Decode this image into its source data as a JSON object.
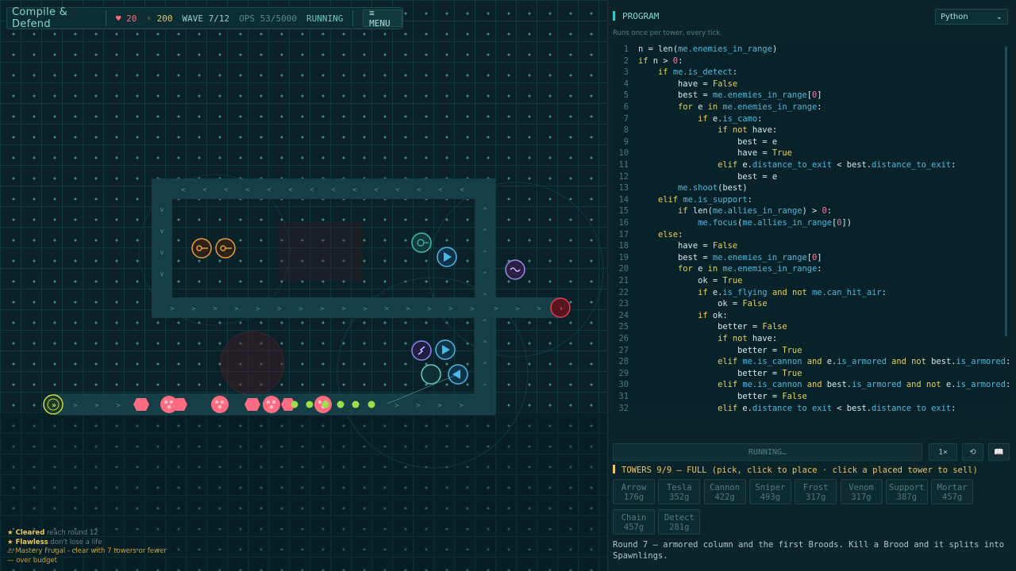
{
  "hud": {
    "title": "Compile & Defend",
    "lives": "♥ 20",
    "gold": "◦ 200",
    "wave": "WAVE 7/12",
    "ops": "OPS 53/5000",
    "state": "RUNNING",
    "menu_label": "≡ MENU"
  },
  "achievements": [
    {
      "name": "★ Cleared",
      "desc": " reach round 12"
    },
    {
      "name": "★ Flawless",
      "desc": " don't lose a life"
    },
    {
      "name": "⚠ Mastery Frugal",
      "desc": " - clear with 7 towers or fewer — over budget"
    }
  ],
  "panel": {
    "title": "PROGRAM",
    "language": "Python",
    "language_arrow": "⌄",
    "subtitle": "Runs once per tower, every tick.",
    "run_status": "RUNNING…",
    "speed_label": "1×",
    "reset_label": "⟲",
    "docs_label": "📖"
  },
  "code": [
    [
      [
        "pl",
        "n = "
      ],
      [
        "fn",
        "len"
      ],
      [
        "pl",
        "("
      ],
      [
        "at",
        "me.enemies_in_range"
      ],
      [
        "pl",
        ")"
      ]
    ],
    [
      [
        "kw",
        "if"
      ],
      [
        "pl",
        " n > "
      ],
      [
        "nm",
        "0"
      ],
      [
        "pl",
        ":"
      ]
    ],
    [
      [
        "pl",
        "    "
      ],
      [
        "kw",
        "if"
      ],
      [
        "pl",
        " "
      ],
      [
        "at",
        "me.is_detect"
      ],
      [
        "pl",
        ":"
      ]
    ],
    [
      [
        "pl",
        "        have = "
      ],
      [
        "kw",
        "False"
      ]
    ],
    [
      [
        "pl",
        "        best = "
      ],
      [
        "at",
        "me.enemies_in_range"
      ],
      [
        "pl",
        "["
      ],
      [
        "nm",
        "0"
      ],
      [
        "pl",
        "]"
      ]
    ],
    [
      [
        "pl",
        "        "
      ],
      [
        "kw",
        "for"
      ],
      [
        "pl",
        " e "
      ],
      [
        "kw",
        "in"
      ],
      [
        "pl",
        " "
      ],
      [
        "at",
        "me.enemies_in_range"
      ],
      [
        "pl",
        ":"
      ]
    ],
    [
      [
        "pl",
        "            "
      ],
      [
        "kw",
        "if"
      ],
      [
        "pl",
        " e."
      ],
      [
        "at",
        "is_camo"
      ],
      [
        "pl",
        ":"
      ]
    ],
    [
      [
        "pl",
        "                "
      ],
      [
        "kw",
        "if not"
      ],
      [
        "pl",
        " have:"
      ]
    ],
    [
      [
        "pl",
        "                    best = e"
      ]
    ],
    [
      [
        "pl",
        "                    have = "
      ],
      [
        "kw",
        "True"
      ]
    ],
    [
      [
        "pl",
        "                "
      ],
      [
        "kw",
        "elif"
      ],
      [
        "pl",
        " e."
      ],
      [
        "at",
        "distance_to_exit"
      ],
      [
        "pl",
        " < best."
      ],
      [
        "at",
        "distance_to_exit"
      ],
      [
        "pl",
        ":"
      ]
    ],
    [
      [
        "pl",
        "                    best = e"
      ]
    ],
    [
      [
        "pl",
        "        "
      ],
      [
        "at",
        "me.shoot"
      ],
      [
        "pl",
        "(best)"
      ]
    ],
    [
      [
        "pl",
        "    "
      ],
      [
        "kw",
        "elif"
      ],
      [
        "pl",
        " "
      ],
      [
        "at",
        "me.is_support"
      ],
      [
        "pl",
        ":"
      ]
    ],
    [
      [
        "pl",
        "        "
      ],
      [
        "kw",
        "if"
      ],
      [
        "pl",
        " "
      ],
      [
        "fn",
        "len"
      ],
      [
        "pl",
        "("
      ],
      [
        "at",
        "me.allies_in_range"
      ],
      [
        "pl",
        ") > "
      ],
      [
        "nm",
        "0"
      ],
      [
        "pl",
        ":"
      ]
    ],
    [
      [
        "pl",
        "            "
      ],
      [
        "at",
        "me.focus"
      ],
      [
        "pl",
        "("
      ],
      [
        "at",
        "me.allies_in_range"
      ],
      [
        "pl",
        "["
      ],
      [
        "nm",
        "0"
      ],
      [
        "pl",
        "])"
      ]
    ],
    [
      [
        "pl",
        "    "
      ],
      [
        "kw",
        "else"
      ],
      [
        "pl",
        ":"
      ]
    ],
    [
      [
        "pl",
        "        have = "
      ],
      [
        "kw",
        "False"
      ]
    ],
    [
      [
        "pl",
        "        best = "
      ],
      [
        "at",
        "me.enemies_in_range"
      ],
      [
        "pl",
        "["
      ],
      [
        "nm",
        "0"
      ],
      [
        "pl",
        "]"
      ]
    ],
    [
      [
        "pl",
        "        "
      ],
      [
        "kw",
        "for"
      ],
      [
        "pl",
        " e "
      ],
      [
        "kw",
        "in"
      ],
      [
        "pl",
        " "
      ],
      [
        "at",
        "me.enemies_in_range"
      ],
      [
        "pl",
        ":"
      ]
    ],
    [
      [
        "pl",
        "            ok = "
      ],
      [
        "kw",
        "True"
      ]
    ],
    [
      [
        "pl",
        "            "
      ],
      [
        "kw",
        "if"
      ],
      [
        "pl",
        " e."
      ],
      [
        "at",
        "is_flying"
      ],
      [
        "pl",
        " "
      ],
      [
        "kw",
        "and not"
      ],
      [
        "pl",
        " "
      ],
      [
        "at",
        "me.can_hit_air"
      ],
      [
        "pl",
        ":"
      ]
    ],
    [
      [
        "pl",
        "                ok = "
      ],
      [
        "kw",
        "False"
      ]
    ],
    [
      [
        "pl",
        "            "
      ],
      [
        "kw",
        "if"
      ],
      [
        "pl",
        " ok:"
      ]
    ],
    [
      [
        "pl",
        "                better = "
      ],
      [
        "kw",
        "False"
      ]
    ],
    [
      [
        "pl",
        "                "
      ],
      [
        "kw",
        "if not"
      ],
      [
        "pl",
        " have:"
      ]
    ],
    [
      [
        "pl",
        "                    better = "
      ],
      [
        "kw",
        "True"
      ]
    ],
    [
      [
        "pl",
        "                "
      ],
      [
        "kw",
        "elif"
      ],
      [
        "pl",
        " "
      ],
      [
        "at",
        "me.is_cannon"
      ],
      [
        "pl",
        " "
      ],
      [
        "kw",
        "and"
      ],
      [
        "pl",
        " e."
      ],
      [
        "at",
        "is_armored"
      ],
      [
        "pl",
        " "
      ],
      [
        "kw",
        "and not"
      ],
      [
        "pl",
        " best."
      ],
      [
        "at",
        "is_armored"
      ],
      [
        "pl",
        ":"
      ]
    ],
    [
      [
        "pl",
        "                    better = "
      ],
      [
        "kw",
        "True"
      ]
    ],
    [
      [
        "pl",
        "                "
      ],
      [
        "kw",
        "elif"
      ],
      [
        "pl",
        " "
      ],
      [
        "at",
        "me.is_cannon"
      ],
      [
        "pl",
        " "
      ],
      [
        "kw",
        "and"
      ],
      [
        "pl",
        " best."
      ],
      [
        "at",
        "is_armored"
      ],
      [
        "pl",
        " "
      ],
      [
        "kw",
        "and not"
      ],
      [
        "pl",
        " e."
      ],
      [
        "at",
        "is_armored"
      ],
      [
        "pl",
        ":"
      ]
    ],
    [
      [
        "pl",
        "                    better = "
      ],
      [
        "kw",
        "False"
      ]
    ],
    [
      [
        "pl",
        "                "
      ],
      [
        "kw",
        "elif"
      ],
      [
        "pl",
        " e."
      ],
      [
        "at",
        "distance_to_exit"
      ],
      [
        "pl",
        " < best."
      ],
      [
        "at",
        "distance_to_exit"
      ],
      [
        "pl",
        ":"
      ]
    ]
  ],
  "towers": {
    "header": "TOWERS  9/9  — FULL  (pick, click to place · click a placed tower to sell)",
    "items": [
      {
        "name": "Arrow",
        "cost": "176g"
      },
      {
        "name": "Tesla",
        "cost": "352g"
      },
      {
        "name": "Cannon",
        "cost": "422g"
      },
      {
        "name": "Sniper",
        "cost": "493g"
      },
      {
        "name": "Frost",
        "cost": "317g"
      },
      {
        "name": "Venom",
        "cost": "317g"
      },
      {
        "name": "Support",
        "cost": "387g"
      },
      {
        "name": "Mortar",
        "cost": "457g"
      },
      {
        "name": "Chain",
        "cost": "457g"
      },
      {
        "name": "Detect",
        "cost": "281g"
      }
    ]
  },
  "round_text": "Round 7 — armored column and the first Broods. Kill a Brood and it splits into Spawnlings.",
  "colors": {
    "enemy": "#ff6b81",
    "spawnling": "#9be04a",
    "path": "#163e46",
    "exit": "#e23c4a",
    "spawn": "#c7d94a",
    "gold": "#e9c46a"
  }
}
